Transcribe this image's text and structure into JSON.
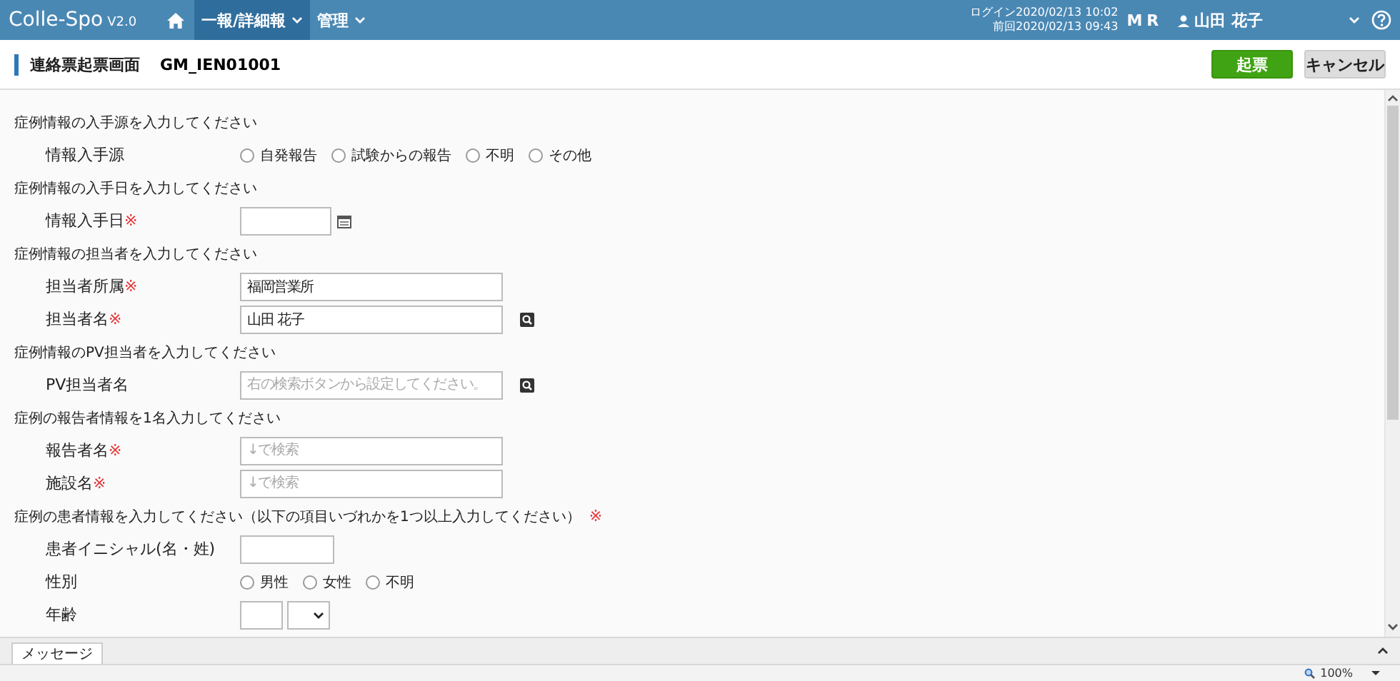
{
  "header": {
    "logo": "Colle-Spo",
    "version": "V2.0",
    "nav": [
      {
        "label": "一報/詳細報",
        "selected": true
      },
      {
        "label": "管理",
        "selected": false
      }
    ],
    "login": "ログイン2020/02/13 10:02",
    "previous": "前回2020/02/13 09:43",
    "role": "MR",
    "user": "山田 花子"
  },
  "page": {
    "title": "連絡票起票画面",
    "code": "GM_IEN01001",
    "buttons": [
      {
        "label": "起票",
        "kind": "primary"
      },
      {
        "label": "キャンセル",
        "kind": "secondary"
      }
    ]
  },
  "sections": [
    {
      "heading": "症例情報の入手源を入力してください",
      "fields": [
        {
          "label": "情報入手源",
          "kind": "radio",
          "options": [
            {
              "label": "自発報告",
              "selected": false
            },
            {
              "label": "試験からの報告",
              "selected": false
            },
            {
              "label": "不明",
              "selected": false
            },
            {
              "label": "その他",
              "selected": false
            }
          ]
        }
      ]
    },
    {
      "heading": "症例情報の入手日を入力してください",
      "fields": [
        {
          "label": "情報入手日",
          "required_mark": "※",
          "kind": "date"
        }
      ]
    },
    {
      "heading": "症例情報の担当者を入力してください",
      "fields": [
        {
          "label": "担当者所属",
          "required_mark": "※",
          "kind": "text",
          "value": "福岡営業所"
        },
        {
          "label": "担当者名",
          "required_mark": "※",
          "kind": "search",
          "value": "山田 花子"
        }
      ]
    },
    {
      "heading": "症例情報のPV担当者を入力してください",
      "fields": [
        {
          "label": "PV担当者名",
          "kind": "search",
          "placeholder": "右の検索ボタンから設定してください。"
        }
      ]
    },
    {
      "heading": "症例の報告者情報を1名入力してください",
      "fields": [
        {
          "label": "報告者名",
          "required_mark": "※",
          "kind": "text",
          "placeholder": "↓で検索"
        },
        {
          "label": "施設名",
          "required_mark": "※",
          "kind": "text",
          "placeholder": "↓で検索"
        }
      ]
    },
    {
      "heading": "症例の患者情報を入力してください（以下の項目いづれかを1つ以上入力してください）",
      "required_mark": "※",
      "fields": [
        {
          "label": "患者イニシャル(名・姓)",
          "kind": "short"
        },
        {
          "label": "性別",
          "kind": "radio",
          "options": [
            {
              "label": "男性",
              "selected": false
            },
            {
              "label": "女性",
              "selected": false
            },
            {
              "label": "不明",
              "selected": false
            }
          ]
        },
        {
          "label": "年齢",
          "kind": "age"
        }
      ]
    }
  ],
  "bottom_tabs": [
    {
      "label": "メッセージ",
      "selected": true
    }
  ],
  "status": {
    "zoom": "100%"
  }
}
